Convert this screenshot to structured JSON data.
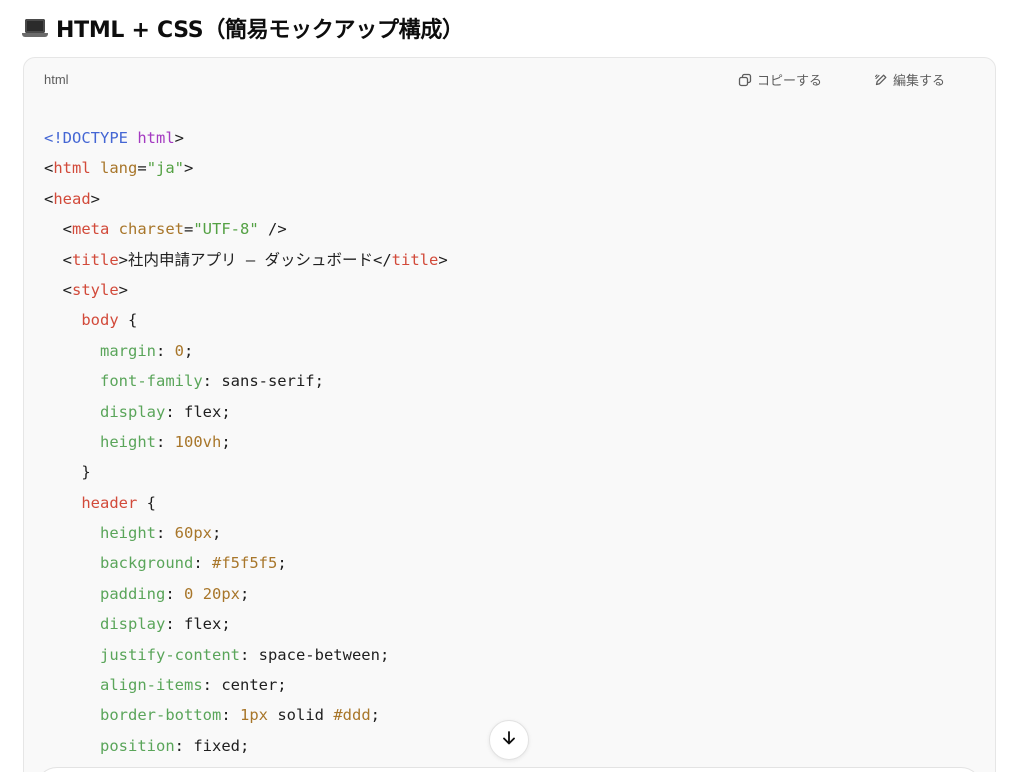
{
  "heading": {
    "icon": "laptop-icon",
    "text": "HTML + CSS（簡易モックアップ構成）"
  },
  "code_block": {
    "language": "html",
    "copy_label": "コピーする",
    "copy_icon": "copy-icon",
    "edit_label": "編集する",
    "edit_icon": "pencil-icon",
    "lines": [
      [
        {
          "t": "doctype",
          "v": "<!DOCTYPE "
        },
        {
          "t": "kw",
          "v": "html"
        },
        {
          "t": "plain",
          "v": ">"
        }
      ],
      [
        {
          "t": "plain",
          "v": "<"
        },
        {
          "t": "tag",
          "v": "html"
        },
        {
          "t": "plain",
          "v": " "
        },
        {
          "t": "attr",
          "v": "lang"
        },
        {
          "t": "plain",
          "v": "="
        },
        {
          "t": "str",
          "v": "\"ja\""
        },
        {
          "t": "plain",
          "v": ">"
        }
      ],
      [
        {
          "t": "plain",
          "v": "<"
        },
        {
          "t": "tag",
          "v": "head"
        },
        {
          "t": "plain",
          "v": ">"
        }
      ],
      [
        {
          "t": "plain",
          "v": "  <"
        },
        {
          "t": "tag",
          "v": "meta"
        },
        {
          "t": "plain",
          "v": " "
        },
        {
          "t": "attr",
          "v": "charset"
        },
        {
          "t": "plain",
          "v": "="
        },
        {
          "t": "str",
          "v": "\"UTF-8\""
        },
        {
          "t": "plain",
          "v": " />"
        }
      ],
      [
        {
          "t": "plain",
          "v": "  <"
        },
        {
          "t": "tag",
          "v": "title"
        },
        {
          "t": "plain",
          "v": ">社内申請アプリ – ダッシュボード</"
        },
        {
          "t": "tag",
          "v": "title"
        },
        {
          "t": "plain",
          "v": ">"
        }
      ],
      [
        {
          "t": "plain",
          "v": "  <"
        },
        {
          "t": "tag",
          "v": "style"
        },
        {
          "t": "plain",
          "v": ">"
        }
      ],
      [
        {
          "t": "plain",
          "v": "    "
        },
        {
          "t": "sel",
          "v": "body"
        },
        {
          "t": "plain",
          "v": " {"
        }
      ],
      [
        {
          "t": "plain",
          "v": "      "
        },
        {
          "t": "prop",
          "v": "margin"
        },
        {
          "t": "plain",
          "v": ": "
        },
        {
          "t": "num",
          "v": "0"
        },
        {
          "t": "plain",
          "v": ";"
        }
      ],
      [
        {
          "t": "plain",
          "v": "      "
        },
        {
          "t": "prop",
          "v": "font-family"
        },
        {
          "t": "plain",
          "v": ": sans-serif;"
        }
      ],
      [
        {
          "t": "plain",
          "v": "      "
        },
        {
          "t": "prop",
          "v": "display"
        },
        {
          "t": "plain",
          "v": ": flex;"
        }
      ],
      [
        {
          "t": "plain",
          "v": "      "
        },
        {
          "t": "prop",
          "v": "height"
        },
        {
          "t": "plain",
          "v": ": "
        },
        {
          "t": "num",
          "v": "100vh"
        },
        {
          "t": "plain",
          "v": ";"
        }
      ],
      [
        {
          "t": "plain",
          "v": "    }"
        }
      ],
      [
        {
          "t": "plain",
          "v": "    "
        },
        {
          "t": "sel",
          "v": "header"
        },
        {
          "t": "plain",
          "v": " {"
        }
      ],
      [
        {
          "t": "plain",
          "v": "      "
        },
        {
          "t": "prop",
          "v": "height"
        },
        {
          "t": "plain",
          "v": ": "
        },
        {
          "t": "num",
          "v": "60px"
        },
        {
          "t": "plain",
          "v": ";"
        }
      ],
      [
        {
          "t": "plain",
          "v": "      "
        },
        {
          "t": "prop",
          "v": "background"
        },
        {
          "t": "plain",
          "v": ": "
        },
        {
          "t": "num",
          "v": "#f5f5f5"
        },
        {
          "t": "plain",
          "v": ";"
        }
      ],
      [
        {
          "t": "plain",
          "v": "      "
        },
        {
          "t": "prop",
          "v": "padding"
        },
        {
          "t": "plain",
          "v": ": "
        },
        {
          "t": "num",
          "v": "0"
        },
        {
          "t": "plain",
          "v": " "
        },
        {
          "t": "num",
          "v": "20px"
        },
        {
          "t": "plain",
          "v": ";"
        }
      ],
      [
        {
          "t": "plain",
          "v": "      "
        },
        {
          "t": "prop",
          "v": "display"
        },
        {
          "t": "plain",
          "v": ": flex;"
        }
      ],
      [
        {
          "t": "plain",
          "v": "      "
        },
        {
          "t": "prop",
          "v": "justify-content"
        },
        {
          "t": "plain",
          "v": ": space-between;"
        }
      ],
      [
        {
          "t": "plain",
          "v": "      "
        },
        {
          "t": "prop",
          "v": "align-items"
        },
        {
          "t": "plain",
          "v": ": center;"
        }
      ],
      [
        {
          "t": "plain",
          "v": "      "
        },
        {
          "t": "prop",
          "v": "border-bottom"
        },
        {
          "t": "plain",
          "v": ": "
        },
        {
          "t": "num",
          "v": "1px"
        },
        {
          "t": "plain",
          "v": " solid "
        },
        {
          "t": "num",
          "v": "#ddd"
        },
        {
          "t": "plain",
          "v": ";"
        }
      ],
      [
        {
          "t": "plain",
          "v": "      "
        },
        {
          "t": "prop",
          "v": "position"
        },
        {
          "t": "plain",
          "v": ": fixed;"
        }
      ]
    ]
  },
  "scroll_button": {
    "icon": "arrow-down-icon"
  }
}
